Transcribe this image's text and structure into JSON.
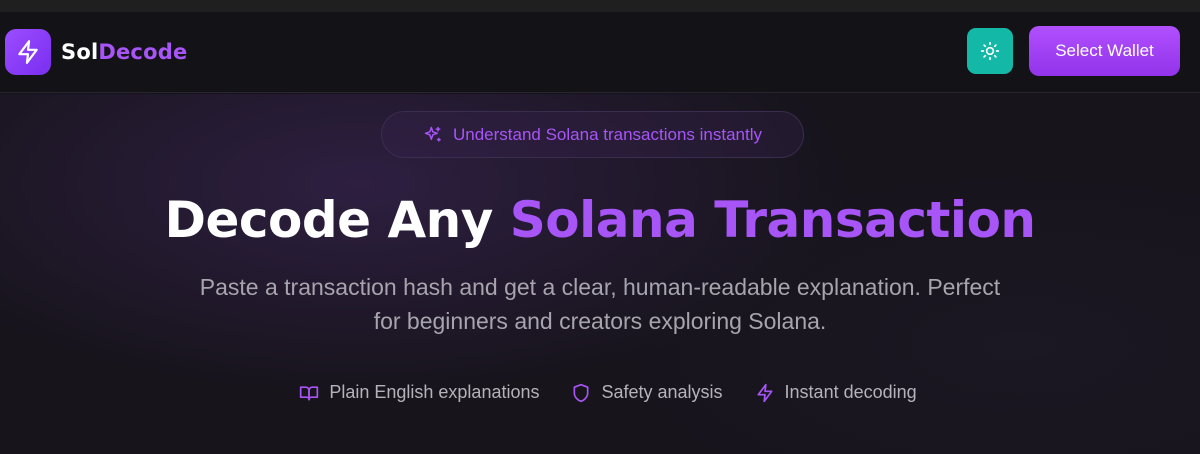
{
  "header": {
    "brand_part1": "Sol",
    "brand_part2": "Decode",
    "logo_icon": "lightning-bolt-icon",
    "theme_toggle_icon": "sun-icon",
    "select_wallet_label": "Select Wallet"
  },
  "hero": {
    "badge_icon": "sparkles-icon",
    "badge_text": "Understand Solana transactions instantly",
    "headline_part1": "Decode Any",
    "headline_part2": "Solana Transaction",
    "subtitle_line1": "Paste a transaction hash and get a clear, human-readable explanation. Perfect",
    "subtitle_line2": "for beginners and creators exploring Solana.",
    "features": [
      {
        "icon": "book-open-icon",
        "label": "Plain English explanations"
      },
      {
        "icon": "shield-icon",
        "label": "Safety analysis"
      },
      {
        "icon": "lightning-bolt-icon",
        "label": "Instant decoding"
      }
    ]
  },
  "colors": {
    "accent_purple": "#a855f7",
    "theme_button_teal": "#14b8a6",
    "background": "#15121b"
  }
}
